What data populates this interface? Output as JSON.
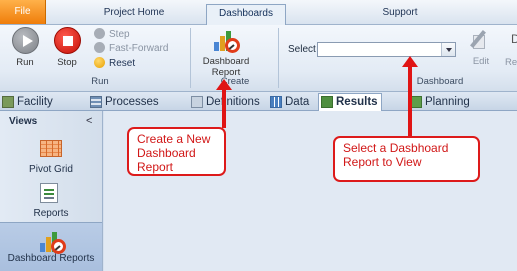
{
  "menu_tabs": {
    "file": "File",
    "project_home": "Project Home",
    "dashboards": "Dashboards",
    "support": "Support"
  },
  "ribbon": {
    "run_group": {
      "run": "Run",
      "stop": "Stop",
      "step": "Step",
      "fast_forward": "Fast-Forward",
      "reset": "Reset",
      "label": "Run"
    },
    "create_group": {
      "dashboard_report": "Dashboard Report",
      "label": "Create"
    },
    "dashboard_group": {
      "select_label": "Select",
      "select_value": "",
      "edit": "Edit",
      "re_partial": "Re",
      "d_partial": "D",
      "label": "Dashboard"
    }
  },
  "view_tabs": {
    "facility": "Facility",
    "processes": "Processes",
    "definitions": "Definitions",
    "data": "Data",
    "results": "Results",
    "planning": "Planning"
  },
  "sidebar": {
    "title": "Views",
    "collapse_glyph": "<",
    "items": [
      {
        "label": "Pivot Grid"
      },
      {
        "label": "Reports"
      },
      {
        "label": "Dashboard Reports"
      }
    ]
  },
  "annotations": {
    "create_callout": "Create a New Dashboard Report",
    "select_callout": "Select a Dasbhoard Report to View"
  },
  "colors": {
    "file_tab": "#ef7d0a",
    "callout_red": "#dd1a1a",
    "stop_red": "#c40f06",
    "sidebar_selected": "#a9bfde"
  }
}
